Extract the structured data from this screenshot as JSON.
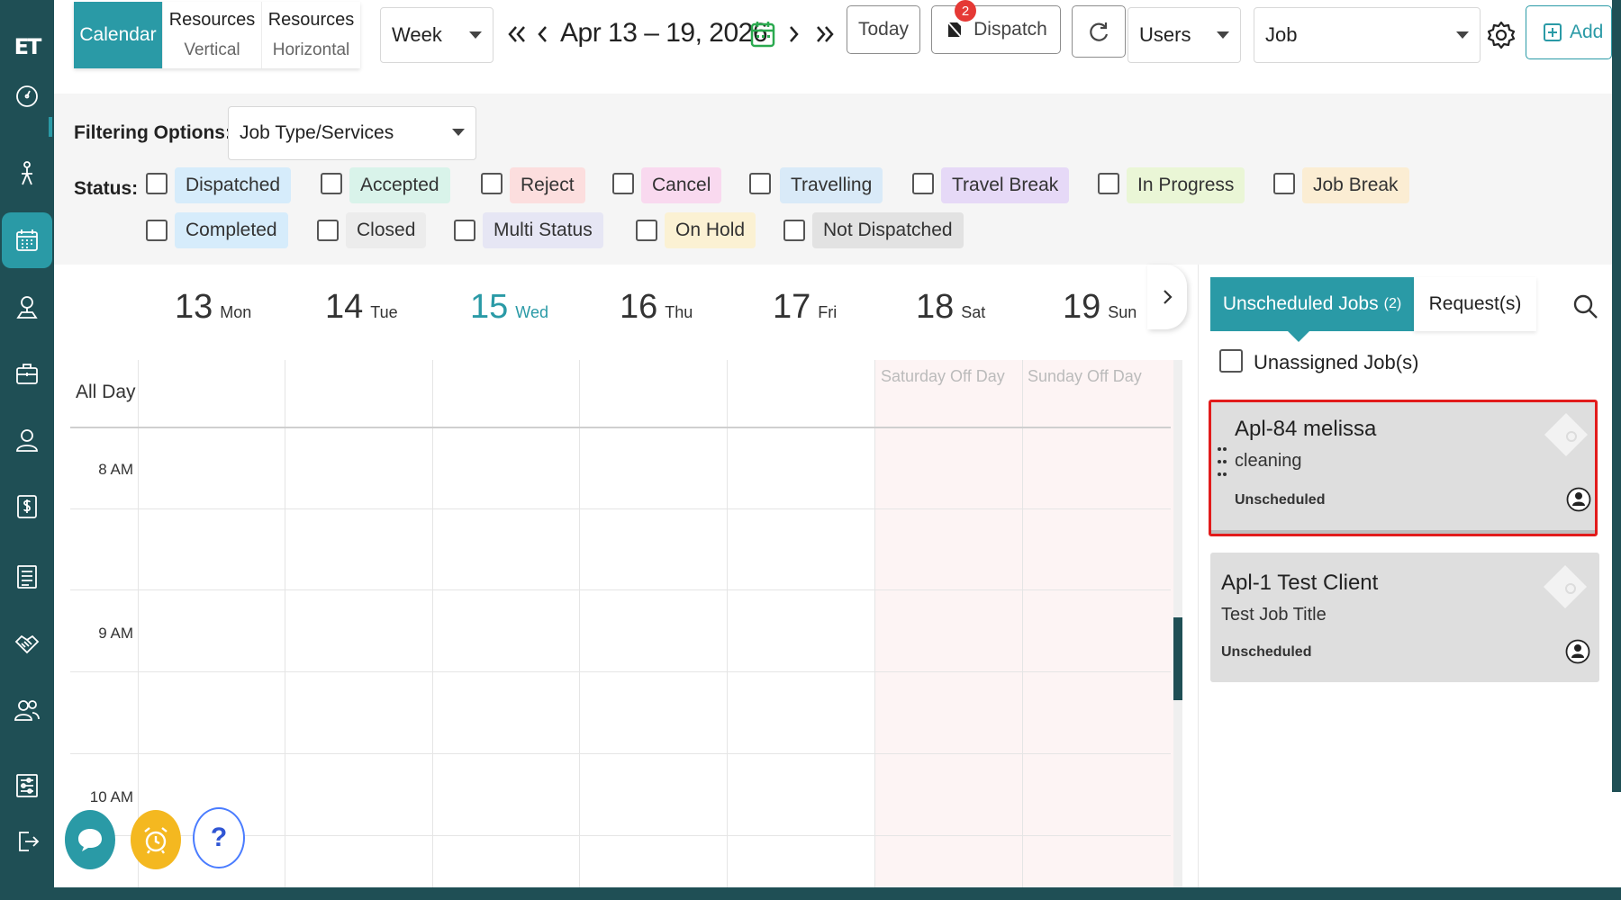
{
  "sidebar": {
    "logo": "ET",
    "items": [
      {
        "name": "dashboard-icon"
      },
      {
        "name": "pin-tool-icon"
      },
      {
        "name": "calendar-icon"
      },
      {
        "name": "map-pin-icon"
      },
      {
        "name": "briefcase-icon"
      },
      {
        "name": "user-icon"
      },
      {
        "name": "dollar-icon"
      },
      {
        "name": "list-icon"
      },
      {
        "name": "handshake-icon"
      },
      {
        "name": "users-icon"
      },
      {
        "name": "settings-sliders-icon"
      },
      {
        "name": "logout-icon"
      }
    ]
  },
  "toolbar": {
    "tabs": [
      {
        "line1": "Calendar",
        "line2": ""
      },
      {
        "line1": "Resources",
        "line2": "Vertical"
      },
      {
        "line1": "Resources",
        "line2": "Horizontal"
      }
    ],
    "view_select": "Week",
    "date_range": "Apr 13 – 19, 2026",
    "today_label": "Today",
    "dispatch_label": "Dispatch",
    "dispatch_badge": "2",
    "users_select": "Users",
    "job_select": "Job",
    "add_label": "Add"
  },
  "filters": {
    "label": "Filtering Options:",
    "select_value": "Job Type/Services",
    "status_label": "Status:",
    "statuses_row1": [
      {
        "label": "Dispatched",
        "color": "#d6ecfb"
      },
      {
        "label": "Accepted",
        "color": "#d9f3ea"
      },
      {
        "label": "Reject",
        "color": "#fcdede"
      },
      {
        "label": "Cancel",
        "color": "#f9d9ef"
      },
      {
        "label": "Travelling",
        "color": "#d9eaf8"
      },
      {
        "label": "Travel Break",
        "color": "#e6d9f7"
      },
      {
        "label": "In Progress",
        "color": "#eaf6d6"
      },
      {
        "label": "Job Break",
        "color": "#fbedd3"
      }
    ],
    "statuses_row2": [
      {
        "label": "Completed",
        "color": "#d6ecfb"
      },
      {
        "label": "Closed",
        "color": "#ececec"
      },
      {
        "label": "Multi Status",
        "color": "#e6e6f4"
      },
      {
        "label": "On Hold",
        "color": "#fbf1d3"
      },
      {
        "label": "Not Dispatched",
        "color": "#e2e2e2"
      }
    ]
  },
  "calendar": {
    "days": [
      {
        "num": "13",
        "name": "Mon"
      },
      {
        "num": "14",
        "name": "Tue"
      },
      {
        "num": "15",
        "name": "Wed",
        "today": true
      },
      {
        "num": "16",
        "name": "Thu"
      },
      {
        "num": "17",
        "name": "Fri"
      },
      {
        "num": "18",
        "name": "Sat"
      },
      {
        "num": "19",
        "name": "Sun"
      }
    ],
    "all_day_label": "All Day",
    "weekend_labels": [
      "Saturday Off Day",
      "Sunday Off Day"
    ],
    "times": [
      "8 AM",
      "9 AM",
      "10 AM"
    ]
  },
  "right_panel": {
    "tab_unscheduled": "Unscheduled Jobs",
    "tab_unscheduled_count": "(2)",
    "tab_requests": "Request(s)",
    "unassigned_label": "Unassigned Job(s)",
    "jobs": [
      {
        "title": "Apl-84 melissa",
        "subtitle": "cleaning",
        "status": "Unscheduled"
      },
      {
        "title": "Apl-1 Test Client",
        "subtitle": "Test Job Title",
        "status": "Unscheduled"
      }
    ]
  },
  "colors": {
    "accent": "#2a9aa6",
    "sidebar": "#1f4f55",
    "selection": "#e21b1b"
  }
}
